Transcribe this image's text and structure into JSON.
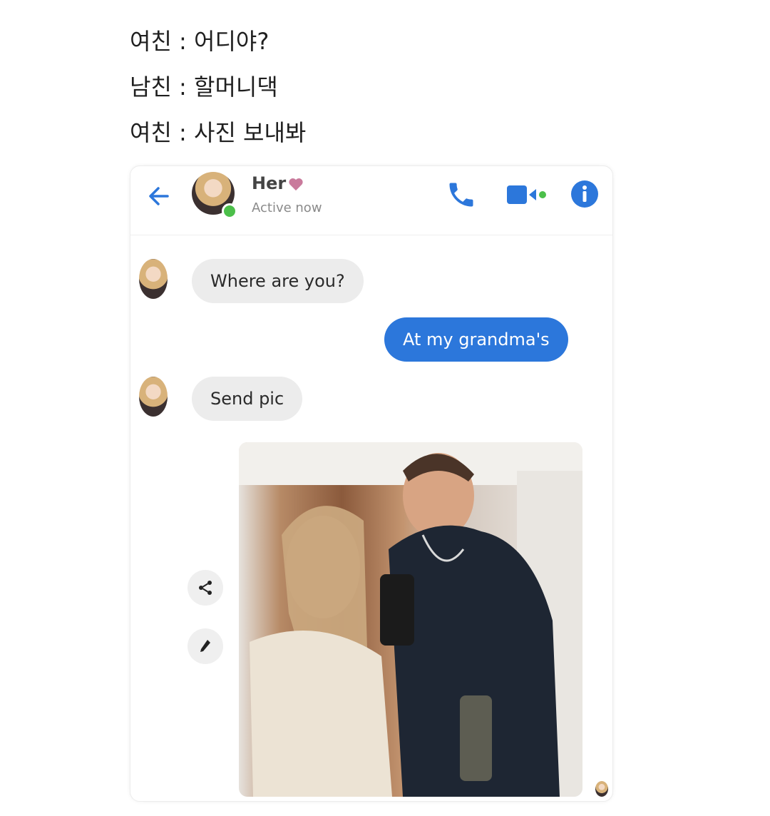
{
  "captions": [
    {
      "speaker": "여친",
      "text": "여친 : 어디야?"
    },
    {
      "speaker": "남친",
      "text": "남친 : 할머니댁"
    },
    {
      "speaker": "여친",
      "text": "여친 : 사진 보내봐"
    }
  ],
  "header": {
    "contact_name": "Her",
    "status": "Active now",
    "icons": [
      "back-arrow-icon",
      "heart-icon",
      "phone-call-icon",
      "video-call-icon",
      "info-icon"
    ]
  },
  "colors": {
    "accent": "#2c77db",
    "incoming_bubble": "#ececec",
    "presence": "#4cbf4a",
    "heart": "#c97a9c"
  },
  "messages": [
    {
      "direction": "incoming",
      "text": "Where are you?"
    },
    {
      "direction": "outgoing",
      "text": "At my grandma's"
    },
    {
      "direction": "incoming",
      "text": "Send pic"
    },
    {
      "direction": "outgoing",
      "type": "photo",
      "description": "mirror selfie of a young man with an older long-haired woman"
    }
  ],
  "photo_actions": [
    "share-icon",
    "edit-pencil-icon"
  ]
}
